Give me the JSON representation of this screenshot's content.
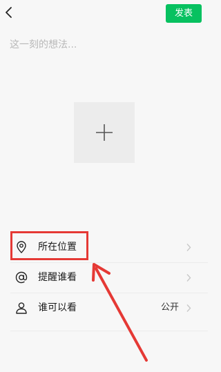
{
  "header": {
    "back_icon": "chevron-left-icon",
    "post_label": "发表"
  },
  "composer": {
    "placeholder": "这一刻的想法...",
    "value": "",
    "add_icon": "plus-icon"
  },
  "options": [
    {
      "icon": "location-pin-icon",
      "label": "所在位置",
      "value": ""
    },
    {
      "icon": "at-sign-icon",
      "label": "提醒谁看",
      "value": ""
    },
    {
      "icon": "person-icon",
      "label": "谁可以看",
      "value": "公开"
    }
  ],
  "colors": {
    "accent": "#07c160",
    "annotation": "#e53935"
  }
}
